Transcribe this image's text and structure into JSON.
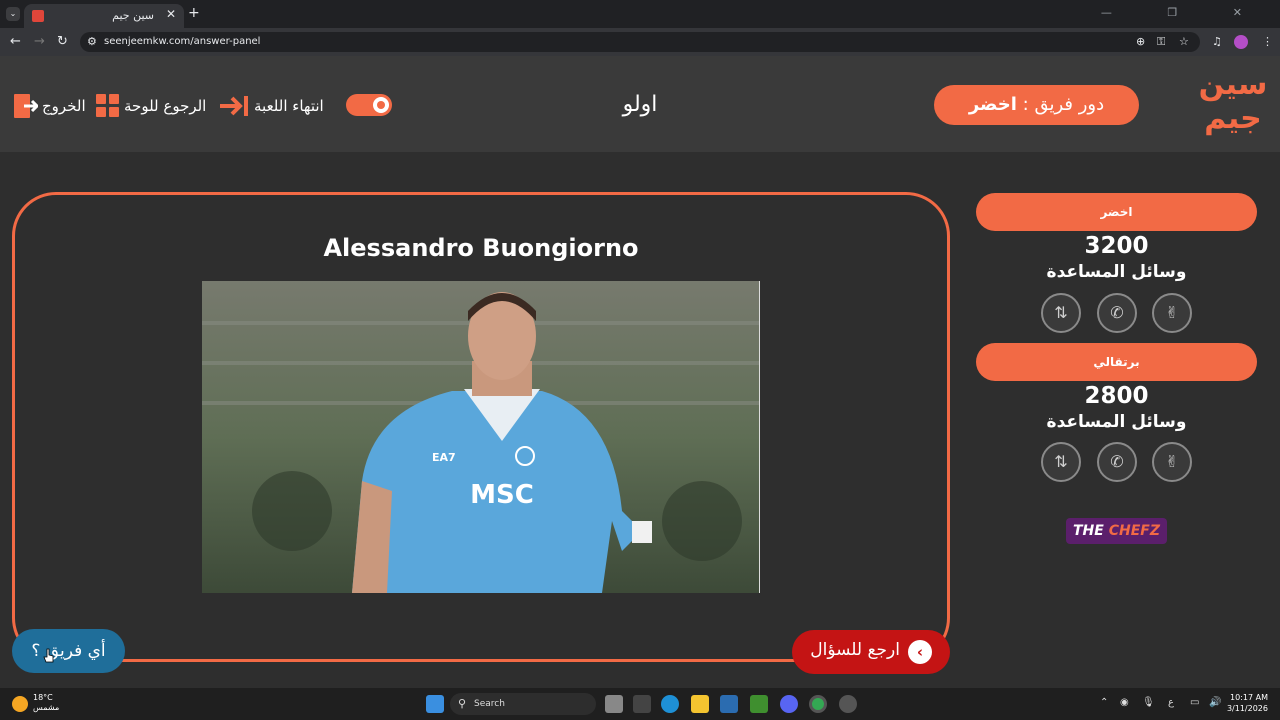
{
  "browser": {
    "tab_title": "سين جيم",
    "tab_close": "✕",
    "new_tab": "+",
    "tab_list": "⌄",
    "url": "seenjeemkw.com/answer-panel",
    "window_controls": "— ❐ ✕"
  },
  "header": {
    "logo_text": "سين جيم",
    "turn_label": "دور فريق : ",
    "turn_team": "اخضر",
    "category": "اولو",
    "end_game": "انتهاء اللعبة",
    "back_to_board": "الرجوع للوحة",
    "exit": "الخروج"
  },
  "question": {
    "answer": "Alessandro Buongiorno",
    "back_button": "ارجع للسؤال",
    "which_team_button": "أي فريق ؟",
    "photo_jersey": "MSC",
    "photo_brand": "EA7"
  },
  "teams": [
    {
      "name": "اخضر",
      "score": "3200",
      "aids_label": "وسائل المساعدة"
    },
    {
      "name": "برتقالي",
      "score": "2800",
      "aids_label": "وسائل المساعدة"
    }
  ],
  "aid_icons": [
    "swap-icon",
    "phone-icon",
    "two-answers-icon"
  ],
  "sponsor": {
    "part1": "THE ",
    "part2": "CHEFZ"
  },
  "taskbar": {
    "weather_temp": "18°C",
    "weather_desc": "مشمس",
    "search_placeholder": "Search",
    "time": "10:17 AM",
    "date": "3/11/2026",
    "lang": "ع"
  },
  "colors": {
    "accent": "#f26a45",
    "back_button": "#c41414",
    "which_team": "#1f6e9a",
    "background": "#2e2e2e"
  }
}
